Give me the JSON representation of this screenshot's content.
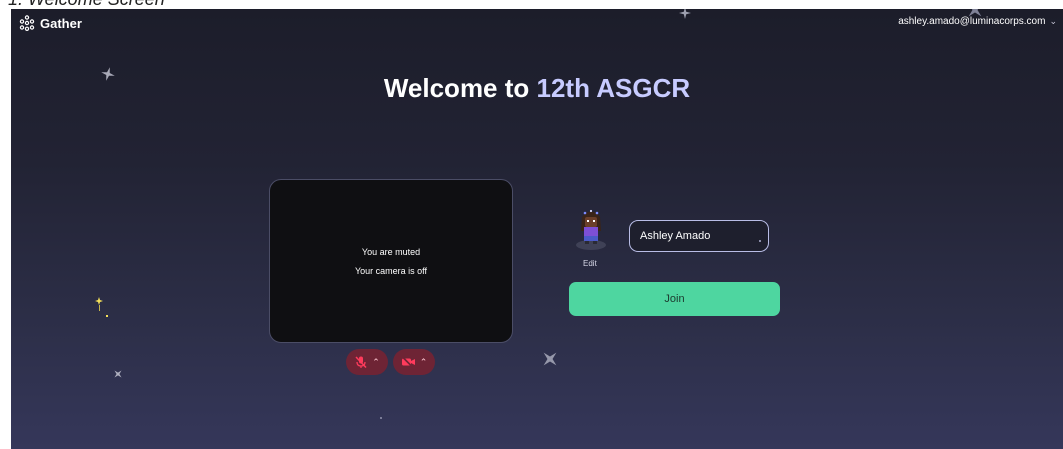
{
  "document": {
    "heading": "1. Welcome Screen"
  },
  "header": {
    "logo_text": "Gather",
    "account_email": "ashley.amado@luminacorps.com"
  },
  "welcome": {
    "prefix": "Welcome to ",
    "space_name": "12th ASGCR"
  },
  "video_preview": {
    "muted_text": "You are muted",
    "camera_off_text": "Your camera is off"
  },
  "controls": {
    "mic": {
      "state": "off",
      "icon": "mic-off-icon"
    },
    "camera": {
      "state": "off",
      "icon": "camera-off-icon"
    }
  },
  "profile": {
    "edit_label": "Edit",
    "name_value": "Ashley Amado",
    "join_label": "Join"
  },
  "colors": {
    "accent": "#4ed6a0",
    "space_name": "#c7cbff",
    "muted_button": "#6e2435",
    "muted_icon": "#ff3b5c"
  }
}
